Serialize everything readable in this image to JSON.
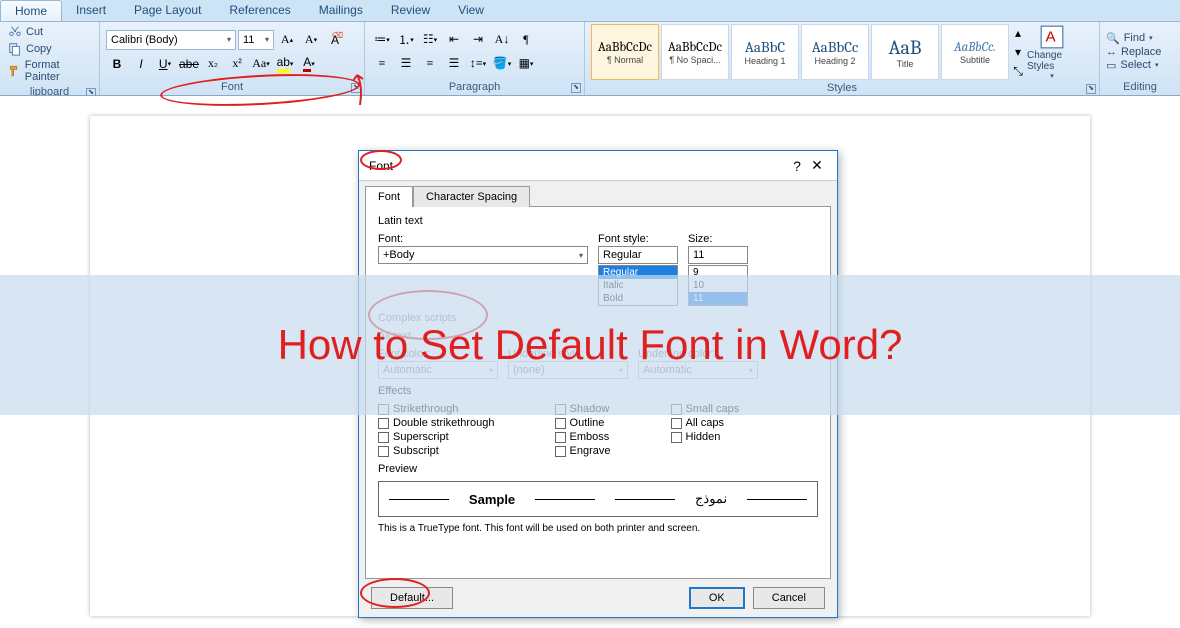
{
  "tabs": [
    "Home",
    "Insert",
    "Page Layout",
    "References",
    "Mailings",
    "Review",
    "View"
  ],
  "activeTab": "Home",
  "clipboard": {
    "cut": "Cut",
    "copy": "Copy",
    "painter": "Format Painter",
    "label": "lipboard"
  },
  "font": {
    "name": "Calibri (Body)",
    "size": "11",
    "label": "Font"
  },
  "paragraph": {
    "label": "Paragraph"
  },
  "styles": {
    "items": [
      {
        "sample": "AaBbCcDc",
        "name": "¶ Normal",
        "cls": ""
      },
      {
        "sample": "AaBbCcDc",
        "name": "¶ No Spaci...",
        "cls": ""
      },
      {
        "sample": "AaBbC",
        "name": "Heading 1",
        "cls": "blue"
      },
      {
        "sample": "AaBbCc",
        "name": "Heading 2",
        "cls": "blue"
      },
      {
        "sample": "AaB",
        "name": "Title",
        "cls": "blue big"
      },
      {
        "sample": "AaBbCc.",
        "name": "Subtitle",
        "cls": "gray"
      }
    ],
    "change": "Change Styles",
    "label": "Styles"
  },
  "editing": {
    "find": "Find",
    "replace": "Replace",
    "select": "Select",
    "label": "Editing"
  },
  "dialog": {
    "title": "Font",
    "help": "?",
    "tabs": [
      "Font",
      "Character Spacing"
    ],
    "latin": "Latin text",
    "fontLbl": "Font:",
    "fontVal": "+Body",
    "styleLbl": "Font style:",
    "styleVal": "Regular",
    "styleList": [
      "Regular",
      "Italic",
      "Bold"
    ],
    "sizeLbl": "Size:",
    "sizeVal": "11",
    "sizeList": [
      "9",
      "10",
      "11"
    ],
    "complex": "Complex scripts",
    "allText": "All text",
    "colorLbl": "Font color:",
    "colorVal": "Automatic",
    "ulineLbl": "Underline style:",
    "ulineVal": "(none)",
    "ucolorLbl": "Underline color:",
    "ucolorVal": "Automatic",
    "effects": "Effects",
    "fx": {
      "c1": [
        "Strikethrough",
        "Double strikethrough",
        "Superscript",
        "Subscript"
      ],
      "c2": [
        "Shadow",
        "Outline",
        "Emboss",
        "Engrave"
      ],
      "c3": [
        "Small caps",
        "All caps",
        "Hidden"
      ]
    },
    "previewLbl": "Preview",
    "sample1": "Sample",
    "sample2": "نموذج",
    "previewNote": "This is a TrueType font. This font will be used on both printer and screen.",
    "default": "Default...",
    "ok": "OK",
    "cancel": "Cancel"
  },
  "overlay": "How to Set Default Font in Word?"
}
